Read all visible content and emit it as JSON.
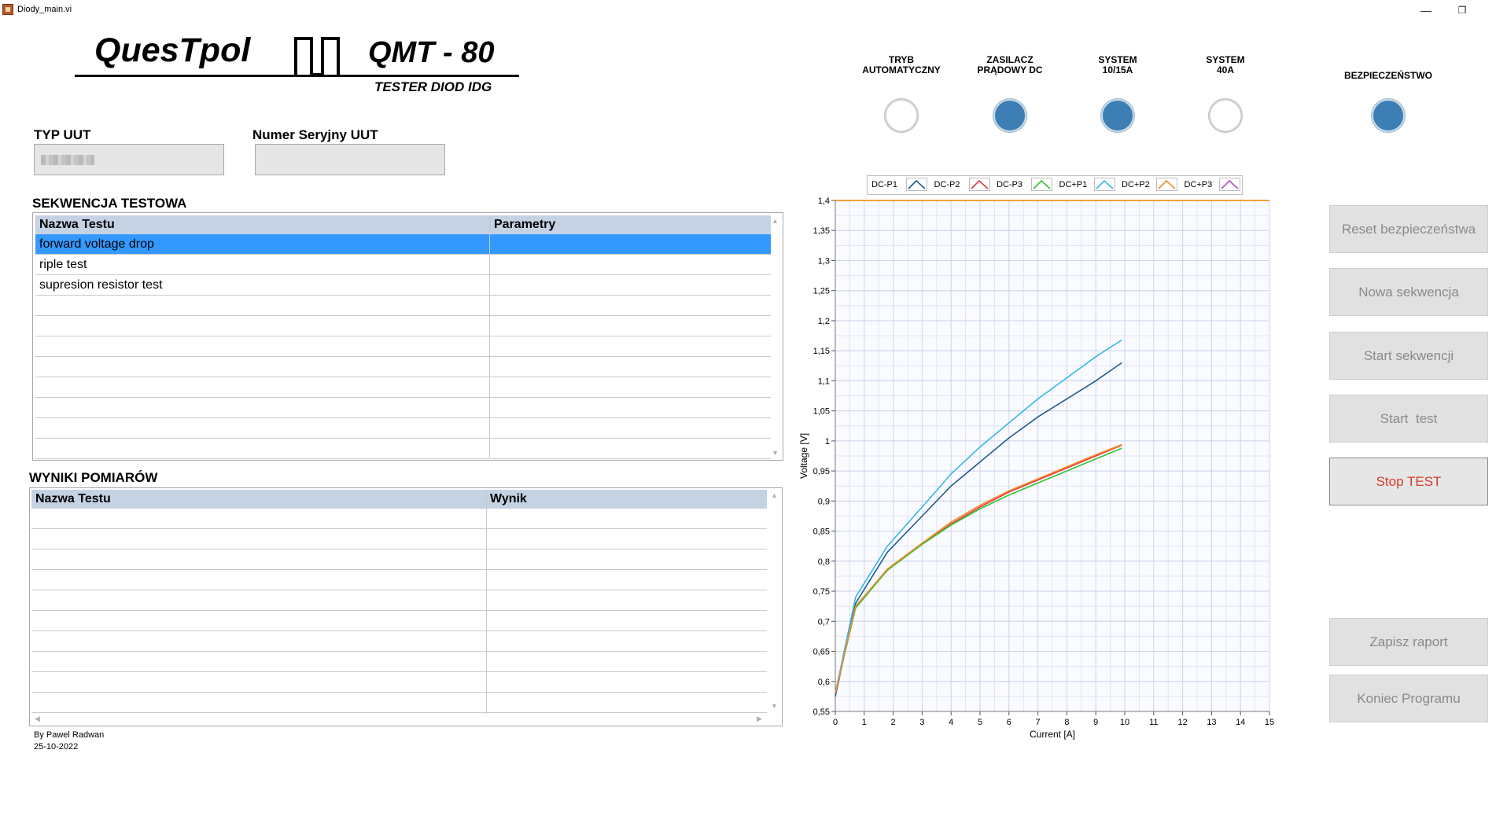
{
  "window": {
    "title": "Diody_main.vi",
    "minimize": "—",
    "restore": "❐"
  },
  "logo": {
    "left": "QuesTpol",
    "right": "QMT - 80",
    "subtitle": "TESTER DIOD IDG"
  },
  "uut": {
    "type_label": "TYP UUT",
    "type_value": "",
    "serial_label": "Numer Seryjny UUT",
    "serial_value": ""
  },
  "sequence": {
    "title": "SEKWENCJA TESTOWA",
    "columns": [
      "Nazwa Testu",
      "Parametry"
    ],
    "rows": [
      [
        "forward voltage drop",
        ""
      ],
      [
        "riple test",
        ""
      ],
      [
        "supresion resistor test",
        ""
      ],
      [
        "",
        ""
      ],
      [
        "",
        ""
      ],
      [
        "",
        ""
      ],
      [
        "",
        ""
      ],
      [
        "",
        ""
      ],
      [
        "",
        ""
      ],
      [
        "",
        ""
      ],
      [
        "",
        ""
      ]
    ],
    "selected_row": 0
  },
  "results": {
    "title": "WYNIKI POMIARÓW",
    "columns": [
      "Nazwa Testu",
      "Wynik"
    ],
    "rows": [
      [
        "",
        ""
      ],
      [
        "",
        ""
      ],
      [
        "",
        ""
      ],
      [
        "",
        ""
      ],
      [
        "",
        ""
      ],
      [
        "",
        ""
      ],
      [
        "",
        ""
      ],
      [
        "",
        ""
      ],
      [
        "",
        ""
      ],
      [
        "",
        ""
      ]
    ]
  },
  "author": {
    "line1": "By Pawel Radwan",
    "line2": "25-10-2022"
  },
  "indicators": [
    {
      "label": "TRYB\nAUTOMATYCZNY",
      "line1": "TRYB",
      "line2": "AUTOMATYCZNY",
      "state": "off"
    },
    {
      "label": "ZASILACZ\nPRĄDOWY DC",
      "line1": "ZASILACZ",
      "line2": "PRĄDOWY DC",
      "state": "on"
    },
    {
      "label": "SYSTEM\n10/15A",
      "line1": "SYSTEM",
      "line2": "10/15A",
      "state": "on"
    },
    {
      "label": "SYSTEM\n40A",
      "line1": "SYSTEM",
      "line2": "40A",
      "state": "off"
    },
    {
      "label": "BEZPIECZEŃSTWO",
      "line1": "",
      "line2": "BEZPIECZEŃSTWO",
      "state": "on"
    }
  ],
  "buttons": {
    "reset": "Reset bezpieczeństwa",
    "new_seq": "Nowa sekwencja",
    "start_seq": "Start sekwencji",
    "start_test": "Start  test",
    "stop_test": "Stop TEST",
    "save_report": "Zapisz raport",
    "exit": "Koniec Programu"
  },
  "colors": {
    "led_on": "#3d7fb5",
    "stop_text": "#d63a2a",
    "header_bg": "#c4d2e4",
    "selection": "#3399ff"
  },
  "chart_data": {
    "type": "line",
    "xlabel": "Current [A]",
    "ylabel": "Voltage [V]",
    "xlim": [
      0,
      15
    ],
    "ylim": [
      0.55,
      1.4
    ],
    "xticks": [
      "0",
      "1",
      "2",
      "3",
      "4",
      "5",
      "6",
      "7",
      "8",
      "9",
      "10",
      "11",
      "12",
      "13",
      "14",
      "15"
    ],
    "yticks": [
      "0,55",
      "0,6",
      "0,65",
      "0,7",
      "0,75",
      "0,8",
      "0,85",
      "0,9",
      "0,95",
      "1",
      "1,05",
      "1,1",
      "1,15",
      "1,2",
      "1,25",
      "1,3",
      "1,35",
      "1,4"
    ],
    "grid": true,
    "legend_position": "top",
    "series": [
      {
        "name": "DC-P1",
        "color": "#1a5a8a",
        "x": [],
        "y": []
      },
      {
        "name": "DC-P2",
        "color": "#1f5c91",
        "x": [
          0,
          0.7,
          1.8,
          3,
          4,
          5,
          6,
          7,
          8,
          9,
          9.9
        ],
        "y": [
          0.575,
          0.73,
          0.815,
          0.875,
          0.925,
          0.965,
          1.005,
          1.04,
          1.07,
          1.1,
          1.13
        ]
      },
      {
        "name": "DC-P3",
        "color": "#e8383e",
        "x": [
          0,
          0.7,
          1.8,
          3,
          4,
          5,
          6,
          7,
          8,
          9,
          9.9
        ],
        "y": [
          0.58,
          0.725,
          0.785,
          0.828,
          0.862,
          0.89,
          0.915,
          0.935,
          0.955,
          0.975,
          0.993
        ]
      },
      {
        "name": "DC+P1",
        "color": "#33c233",
        "x": [
          0,
          0.7,
          1.8,
          3,
          4,
          5,
          6,
          7,
          8,
          9,
          9.9
        ],
        "y": [
          0.58,
          0.722,
          0.785,
          0.828,
          0.86,
          0.887,
          0.91,
          0.93,
          0.95,
          0.97,
          0.988
        ]
      },
      {
        "name": "DC+P2",
        "color": "#38b6e8",
        "x": [
          0,
          0.7,
          1.8,
          3,
          4,
          5,
          6,
          7,
          8,
          9,
          9.9
        ],
        "y": [
          0.58,
          0.74,
          0.825,
          0.89,
          0.945,
          0.99,
          1.03,
          1.07,
          1.105,
          1.14,
          1.168
        ]
      },
      {
        "name": "DC+P3",
        "color": "#f28c28",
        "x": [
          0,
          0.7,
          1.8,
          3,
          4,
          5,
          6,
          7,
          8,
          9,
          9.9
        ],
        "y": [
          0.58,
          0.725,
          0.787,
          0.83,
          0.865,
          0.893,
          0.917,
          0.937,
          0.957,
          0.977,
          0.994
        ]
      }
    ],
    "extra_legend": [
      {
        "name": "",
        "color": "#b44fd6"
      }
    ],
    "reference_line": {
      "y": 1.4,
      "color": "#f2a03a"
    }
  }
}
